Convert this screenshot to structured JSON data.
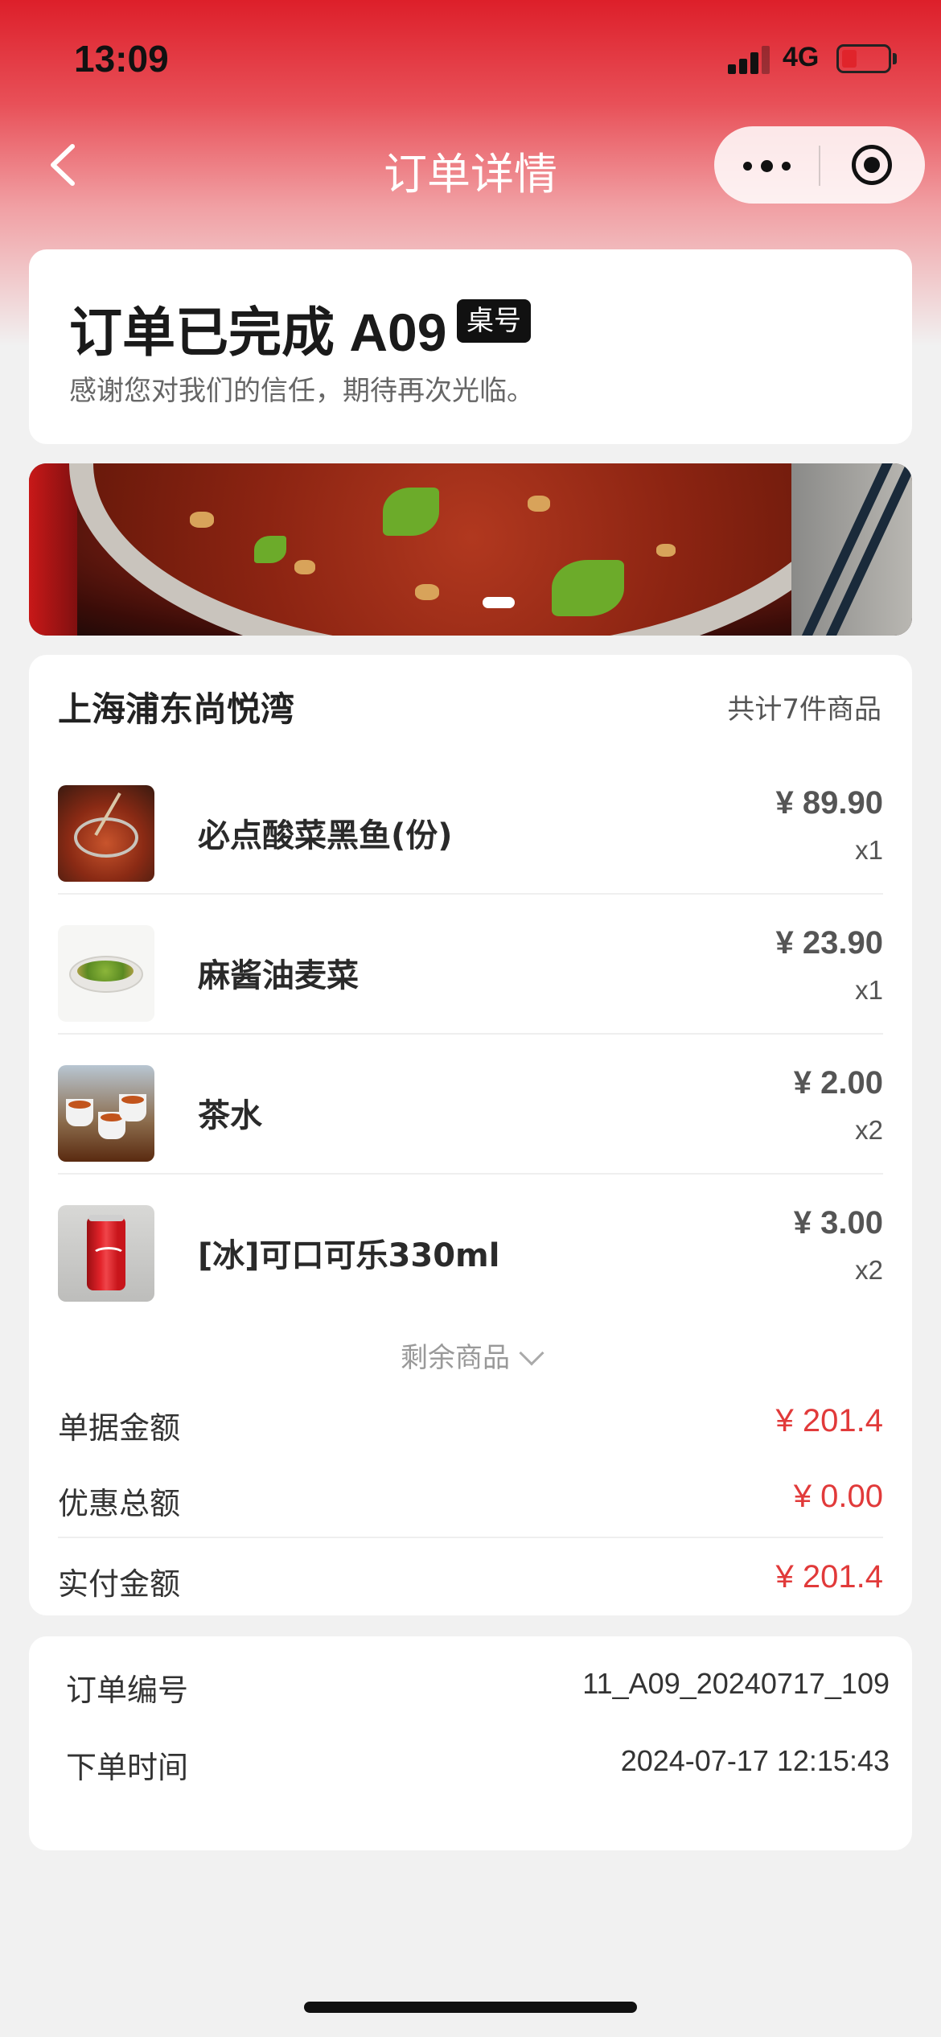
{
  "status_bar": {
    "time": "13:09",
    "network": "4G"
  },
  "nav": {
    "title": "订单详情",
    "back_icon": "chevron-left-icon",
    "more_icon": "more-dots-icon",
    "close_icon": "target-circle-icon"
  },
  "order_status": {
    "title": "订单已完成",
    "table_number": "A09",
    "table_tag": "桌号",
    "subtitle": "感谢您对我们的信任，期待再次光临。"
  },
  "store": {
    "name": "上海浦东尚悦湾",
    "item_count_text": "共计7件商品"
  },
  "items": [
    {
      "name": "必点酸菜黑鱼(份)",
      "price": "¥ 89.90",
      "qty": "x1"
    },
    {
      "name": "麻酱油麦菜",
      "price": "¥ 23.90",
      "qty": "x1"
    },
    {
      "name": "茶水",
      "price": "¥ 2.00",
      "qty": "x2"
    },
    {
      "name": "[冰]可口可乐330ml",
      "price": "¥ 3.00",
      "qty": "x2"
    }
  ],
  "more_items_label": "剩余商品",
  "summary": {
    "bill_label": "单据金额",
    "bill_value": "¥ 201.4",
    "discount_label": "优惠总额",
    "discount_value": "¥ 0.00",
    "paid_label": "实付金额",
    "paid_value": "¥ 201.4"
  },
  "order_info": {
    "number_label": "订单编号",
    "number_value": "11_A09_20240717_109",
    "time_label": "下单时间",
    "time_value": "2024-07-17 12:15:43"
  },
  "colors": {
    "accent_red": "#e13a3a",
    "header_red": "#dd1f2a"
  }
}
